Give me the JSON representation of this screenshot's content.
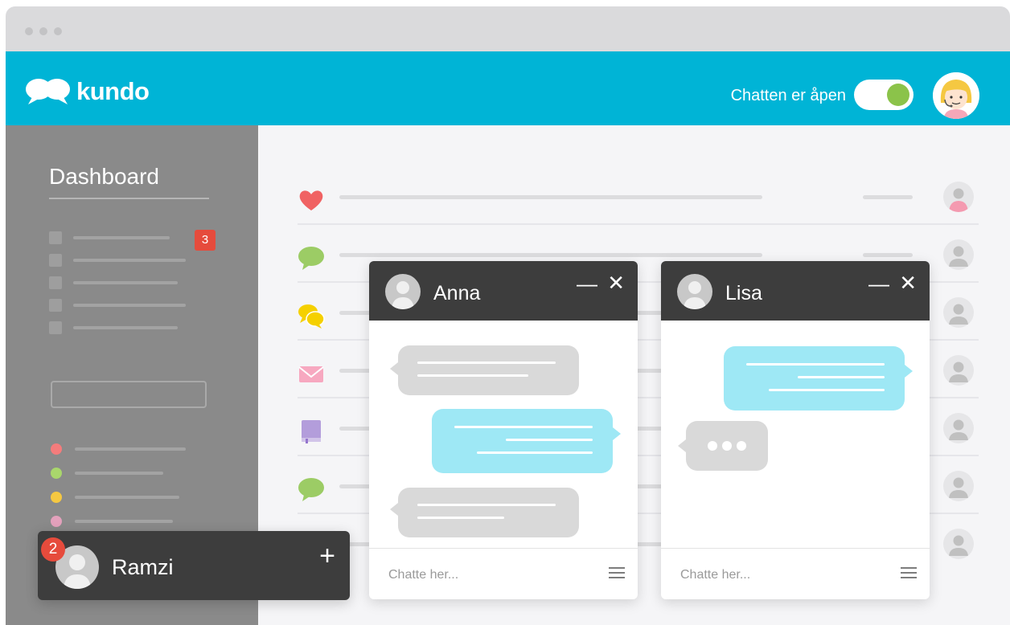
{
  "window": {
    "dots": 3
  },
  "header": {
    "logo_text": "kundo",
    "chat_status": "Chatten er åpen",
    "toggle_on": true
  },
  "sidebar": {
    "title": "Dashboard",
    "badge_count": "3",
    "list_items": 5,
    "dot_colors": [
      "#f47c7c",
      "#a9d66c",
      "#f5c842",
      "#e3a1bc"
    ]
  },
  "conversations": {
    "row_icons": [
      "heart-icon",
      "speech-bubble-icon",
      "speech-bubbles-icon",
      "envelope-icon",
      "book-icon",
      "speech-bubble-icon",
      "speech-bubble-icon"
    ]
  },
  "chats": [
    {
      "name": "Anna",
      "minimize_label": "—",
      "close_label": "✕",
      "placeholder": "Chatte her...",
      "messages": [
        "incoming",
        "outgoing",
        "incoming"
      ]
    },
    {
      "name": "Lisa",
      "minimize_label": "—",
      "close_label": "✕",
      "placeholder": "Chatte her...",
      "messages": [
        "outgoing",
        "typing"
      ]
    }
  ],
  "minimized_chat": {
    "name": "Ramzi",
    "badge": "2",
    "plus_label": "+"
  },
  "colors": {
    "brand": "#00b4d6",
    "online": "#8bc34a",
    "badge": "#e64b3c",
    "incoming_bubble": "#d9d9d9",
    "outgoing_bubble": "#9ee8f5",
    "chat_header": "#3d3d3d"
  }
}
